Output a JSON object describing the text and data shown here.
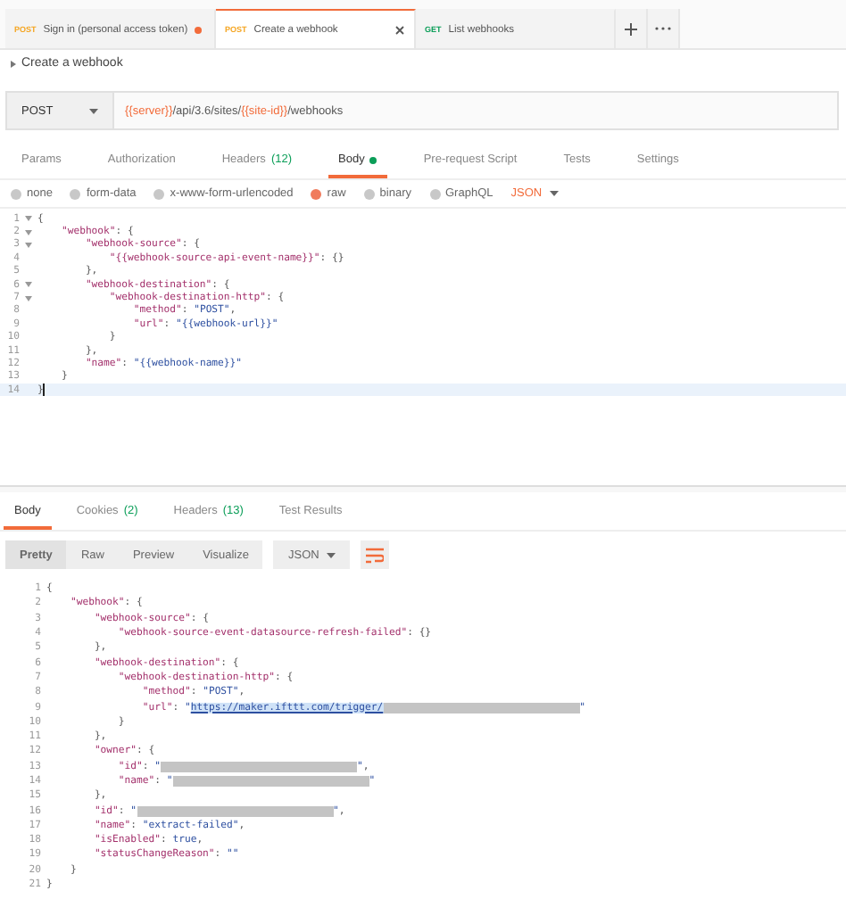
{
  "request_tabs": [
    {
      "method": "POST",
      "title": "Sign in (personal access token)",
      "selected": false,
      "unsaved": true
    },
    {
      "method": "POST",
      "title": "Create a webhook",
      "selected": true,
      "unsaved": false
    },
    {
      "method": "GET",
      "title": "List webhooks",
      "selected": false,
      "unsaved": false
    }
  ],
  "request_name": "Create a webhook",
  "url_bar": {
    "method": "POST",
    "url": [
      {
        "kind": "var",
        "text": "{{server}}"
      },
      {
        "kind": "plain",
        "text": "/api/3.6/sites/"
      },
      {
        "kind": "var",
        "text": "{{site-id}}"
      },
      {
        "kind": "plain",
        "text": "/webhooks"
      }
    ]
  },
  "request_sections": [
    {
      "label": "Params",
      "selected": false
    },
    {
      "label": "Authorization",
      "selected": false
    },
    {
      "label": "Headers",
      "count": "(12)",
      "selected": false
    },
    {
      "label": "Body",
      "selected": true,
      "dot": true
    },
    {
      "label": "Pre-request Script",
      "selected": false
    },
    {
      "label": "Tests",
      "selected": false
    },
    {
      "label": "Settings",
      "selected": false
    }
  ],
  "body_types": [
    {
      "label": "none",
      "selected": false
    },
    {
      "label": "form-data",
      "selected": false
    },
    {
      "label": "x-www-form-urlencoded",
      "selected": false
    },
    {
      "label": "raw",
      "selected": true
    },
    {
      "label": "binary",
      "selected": false
    },
    {
      "label": "GraphQL",
      "selected": false
    }
  ],
  "body_format": "JSON",
  "request_editor": [
    {
      "number": "1",
      "foldable": true,
      "current": false,
      "tokens": [
        {
          "kind": "punct",
          "text": "{"
        }
      ]
    },
    {
      "number": "2",
      "foldable": true,
      "current": false,
      "tokens": [
        {
          "kind": "key",
          "text": "    \"webhook\""
        },
        {
          "kind": "punct",
          "text": ": {"
        }
      ]
    },
    {
      "number": "3",
      "foldable": true,
      "current": false,
      "tokens": [
        {
          "kind": "key",
          "text": "        \"webhook-source\""
        },
        {
          "kind": "punct",
          "text": ": {"
        }
      ]
    },
    {
      "number": "4",
      "foldable": false,
      "current": false,
      "tokens": [
        {
          "kind": "key",
          "text": "            \"{{webhook-source-api-event-name}}\""
        },
        {
          "kind": "punct",
          "text": ": {}"
        }
      ]
    },
    {
      "number": "5",
      "foldable": false,
      "current": false,
      "tokens": [
        {
          "kind": "punct",
          "text": "        },"
        }
      ]
    },
    {
      "number": "6",
      "foldable": true,
      "current": false,
      "tokens": [
        {
          "kind": "key",
          "text": "        \"webhook-destination\""
        },
        {
          "kind": "punct",
          "text": ": {"
        }
      ]
    },
    {
      "number": "7",
      "foldable": true,
      "current": false,
      "tokens": [
        {
          "kind": "key",
          "text": "            \"webhook-destination-http\""
        },
        {
          "kind": "punct",
          "text": ": {"
        }
      ]
    },
    {
      "number": "8",
      "foldable": false,
      "current": false,
      "tokens": [
        {
          "kind": "key",
          "text": "                \"method\""
        },
        {
          "kind": "punct",
          "text": ": "
        },
        {
          "kind": "string",
          "text": "\"POST\""
        },
        {
          "kind": "punct",
          "text": ","
        }
      ]
    },
    {
      "number": "9",
      "foldable": false,
      "current": false,
      "tokens": [
        {
          "kind": "key",
          "text": "                \"url\""
        },
        {
          "kind": "punct",
          "text": ": "
        },
        {
          "kind": "string",
          "text": "\"{{webhook-url}}\""
        }
      ]
    },
    {
      "number": "10",
      "foldable": false,
      "current": false,
      "tokens": [
        {
          "kind": "punct",
          "text": "            }"
        }
      ]
    },
    {
      "number": "11",
      "foldable": false,
      "current": false,
      "tokens": [
        {
          "kind": "punct",
          "text": "        },"
        }
      ]
    },
    {
      "number": "12",
      "foldable": false,
      "current": false,
      "tokens": [
        {
          "kind": "key",
          "text": "        \"name\""
        },
        {
          "kind": "punct",
          "text": ": "
        },
        {
          "kind": "string",
          "text": "\"{{webhook-name}}\""
        }
      ]
    },
    {
      "number": "13",
      "foldable": false,
      "current": false,
      "tokens": [
        {
          "kind": "punct",
          "text": "    }"
        }
      ]
    },
    {
      "number": "14",
      "foldable": false,
      "current": true,
      "tokens": [
        {
          "kind": "punct",
          "text": "}"
        }
      ]
    }
  ],
  "response_tabs": [
    {
      "label": "Body",
      "selected": true
    },
    {
      "label": "Cookies",
      "count": "(2)",
      "selected": false
    },
    {
      "label": "Headers",
      "count": "(13)",
      "selected": false
    },
    {
      "label": "Test Results",
      "selected": false
    }
  ],
  "view_modes": [
    {
      "label": "Pretty",
      "selected": true
    },
    {
      "label": "Raw",
      "selected": false
    },
    {
      "label": "Preview",
      "selected": false
    },
    {
      "label": "Visualize",
      "selected": false
    }
  ],
  "response_format": "JSON",
  "response_editor": [
    {
      "number": "1",
      "tokens": [
        {
          "kind": "punct",
          "text": "{"
        }
      ]
    },
    {
      "number": "2",
      "tokens": [
        {
          "kind": "key",
          "text": "    \"webhook\""
        },
        {
          "kind": "punct",
          "text": ": {"
        }
      ]
    },
    {
      "number": "3",
      "tokens": [
        {
          "kind": "key",
          "text": "        \"webhook-source\""
        },
        {
          "kind": "punct",
          "text": ": {"
        }
      ]
    },
    {
      "number": "4",
      "tokens": [
        {
          "kind": "key",
          "text": "            \"webhook-source-event-datasource-refresh-failed\""
        },
        {
          "kind": "punct",
          "text": ": {}"
        }
      ]
    },
    {
      "number": "5",
      "tokens": [
        {
          "kind": "punct",
          "text": "        },"
        }
      ]
    },
    {
      "number": "6",
      "tokens": [
        {
          "kind": "key",
          "text": "        \"webhook-destination\""
        },
        {
          "kind": "punct",
          "text": ": {"
        }
      ]
    },
    {
      "number": "7",
      "tokens": [
        {
          "kind": "key",
          "text": "            \"webhook-destination-http\""
        },
        {
          "kind": "punct",
          "text": ": {"
        }
      ]
    },
    {
      "number": "8",
      "tokens": [
        {
          "kind": "key",
          "text": "                \"method\""
        },
        {
          "kind": "punct",
          "text": ": "
        },
        {
          "kind": "string",
          "text": "\"POST\""
        },
        {
          "kind": "punct",
          "text": ","
        }
      ]
    },
    {
      "number": "9",
      "tokens": [
        {
          "kind": "key",
          "text": "                \"url\""
        },
        {
          "kind": "punct",
          "text": ": "
        },
        {
          "kind": "string",
          "text": "\""
        },
        {
          "kind": "link",
          "text": "https://maker.ifttt.com/trigger/"
        },
        {
          "kind": "redacted"
        },
        {
          "kind": "string",
          "text": "\""
        }
      ]
    },
    {
      "number": "10",
      "tokens": [
        {
          "kind": "punct",
          "text": "            }"
        }
      ]
    },
    {
      "number": "11",
      "tokens": [
        {
          "kind": "punct",
          "text": "        },"
        }
      ]
    },
    {
      "number": "12",
      "tokens": [
        {
          "kind": "key",
          "text": "        \"owner\""
        },
        {
          "kind": "punct",
          "text": ": {"
        }
      ]
    },
    {
      "number": "13",
      "tokens": [
        {
          "kind": "key",
          "text": "            \"id\""
        },
        {
          "kind": "punct",
          "text": ": "
        },
        {
          "kind": "string",
          "text": "\""
        },
        {
          "kind": "redacted"
        },
        {
          "kind": "string",
          "text": "\""
        },
        {
          "kind": "punct",
          "text": ","
        }
      ]
    },
    {
      "number": "14",
      "tokens": [
        {
          "kind": "key",
          "text": "            \"name\""
        },
        {
          "kind": "punct",
          "text": ": "
        },
        {
          "kind": "string",
          "text": "\""
        },
        {
          "kind": "redacted"
        },
        {
          "kind": "string",
          "text": "\""
        }
      ]
    },
    {
      "number": "15",
      "tokens": [
        {
          "kind": "punct",
          "text": "        },"
        }
      ]
    },
    {
      "number": "16",
      "tokens": [
        {
          "kind": "key",
          "text": "        \"id\""
        },
        {
          "kind": "punct",
          "text": ": "
        },
        {
          "kind": "string",
          "text": "\""
        },
        {
          "kind": "redacted"
        },
        {
          "kind": "string",
          "text": "\""
        },
        {
          "kind": "punct",
          "text": ","
        }
      ]
    },
    {
      "number": "17",
      "tokens": [
        {
          "kind": "key",
          "text": "        \"name\""
        },
        {
          "kind": "punct",
          "text": ": "
        },
        {
          "kind": "string",
          "text": "\"extract-failed\""
        },
        {
          "kind": "punct",
          "text": ","
        }
      ]
    },
    {
      "number": "18",
      "tokens": [
        {
          "kind": "key",
          "text": "        \"isEnabled\""
        },
        {
          "kind": "punct",
          "text": ": "
        },
        {
          "kind": "literal",
          "text": "true"
        },
        {
          "kind": "punct",
          "text": ","
        }
      ]
    },
    {
      "number": "19",
      "tokens": [
        {
          "kind": "key",
          "text": "        \"statusChangeReason\""
        },
        {
          "kind": "punct",
          "text": ": "
        },
        {
          "kind": "string",
          "text": "\"\""
        }
      ]
    },
    {
      "number": "20",
      "tokens": [
        {
          "kind": "punct",
          "text": "    }"
        }
      ]
    },
    {
      "number": "21",
      "tokens": [
        {
          "kind": "punct",
          "text": "}"
        }
      ]
    }
  ]
}
